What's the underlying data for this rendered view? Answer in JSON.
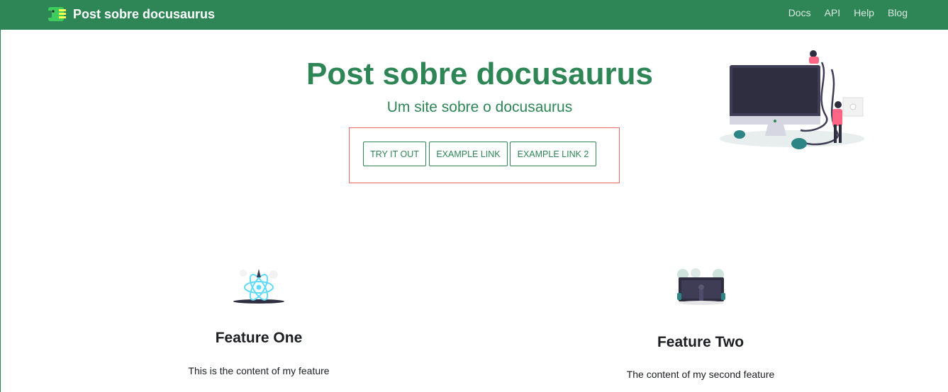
{
  "navbar": {
    "brand_title": "Post sobre docusaurus",
    "links": [
      "Docs",
      "API",
      "Help",
      "Blog"
    ],
    "logo_icon": "docusaurus-dino-logo-icon"
  },
  "hero": {
    "title": "Post sobre docusaurus",
    "subtitle": "Um site sobre o docusaurus",
    "buttons": [
      "TRY IT OUT",
      "EXAMPLE LINK",
      "EXAMPLE LINK 2"
    ],
    "illustration": "monitor-with-people-illustration"
  },
  "features": [
    {
      "title": "Feature One",
      "text": "This is the content of my feature",
      "illustration": "react-atom-illustration"
    },
    {
      "title": "Feature Two",
      "text": "The content of my second feature",
      "illustration": "desk-screen-illustration"
    }
  ],
  "colors": {
    "primary": "#2e8555",
    "highlight_box": "#e86a6a",
    "text": "#1c1e21"
  }
}
